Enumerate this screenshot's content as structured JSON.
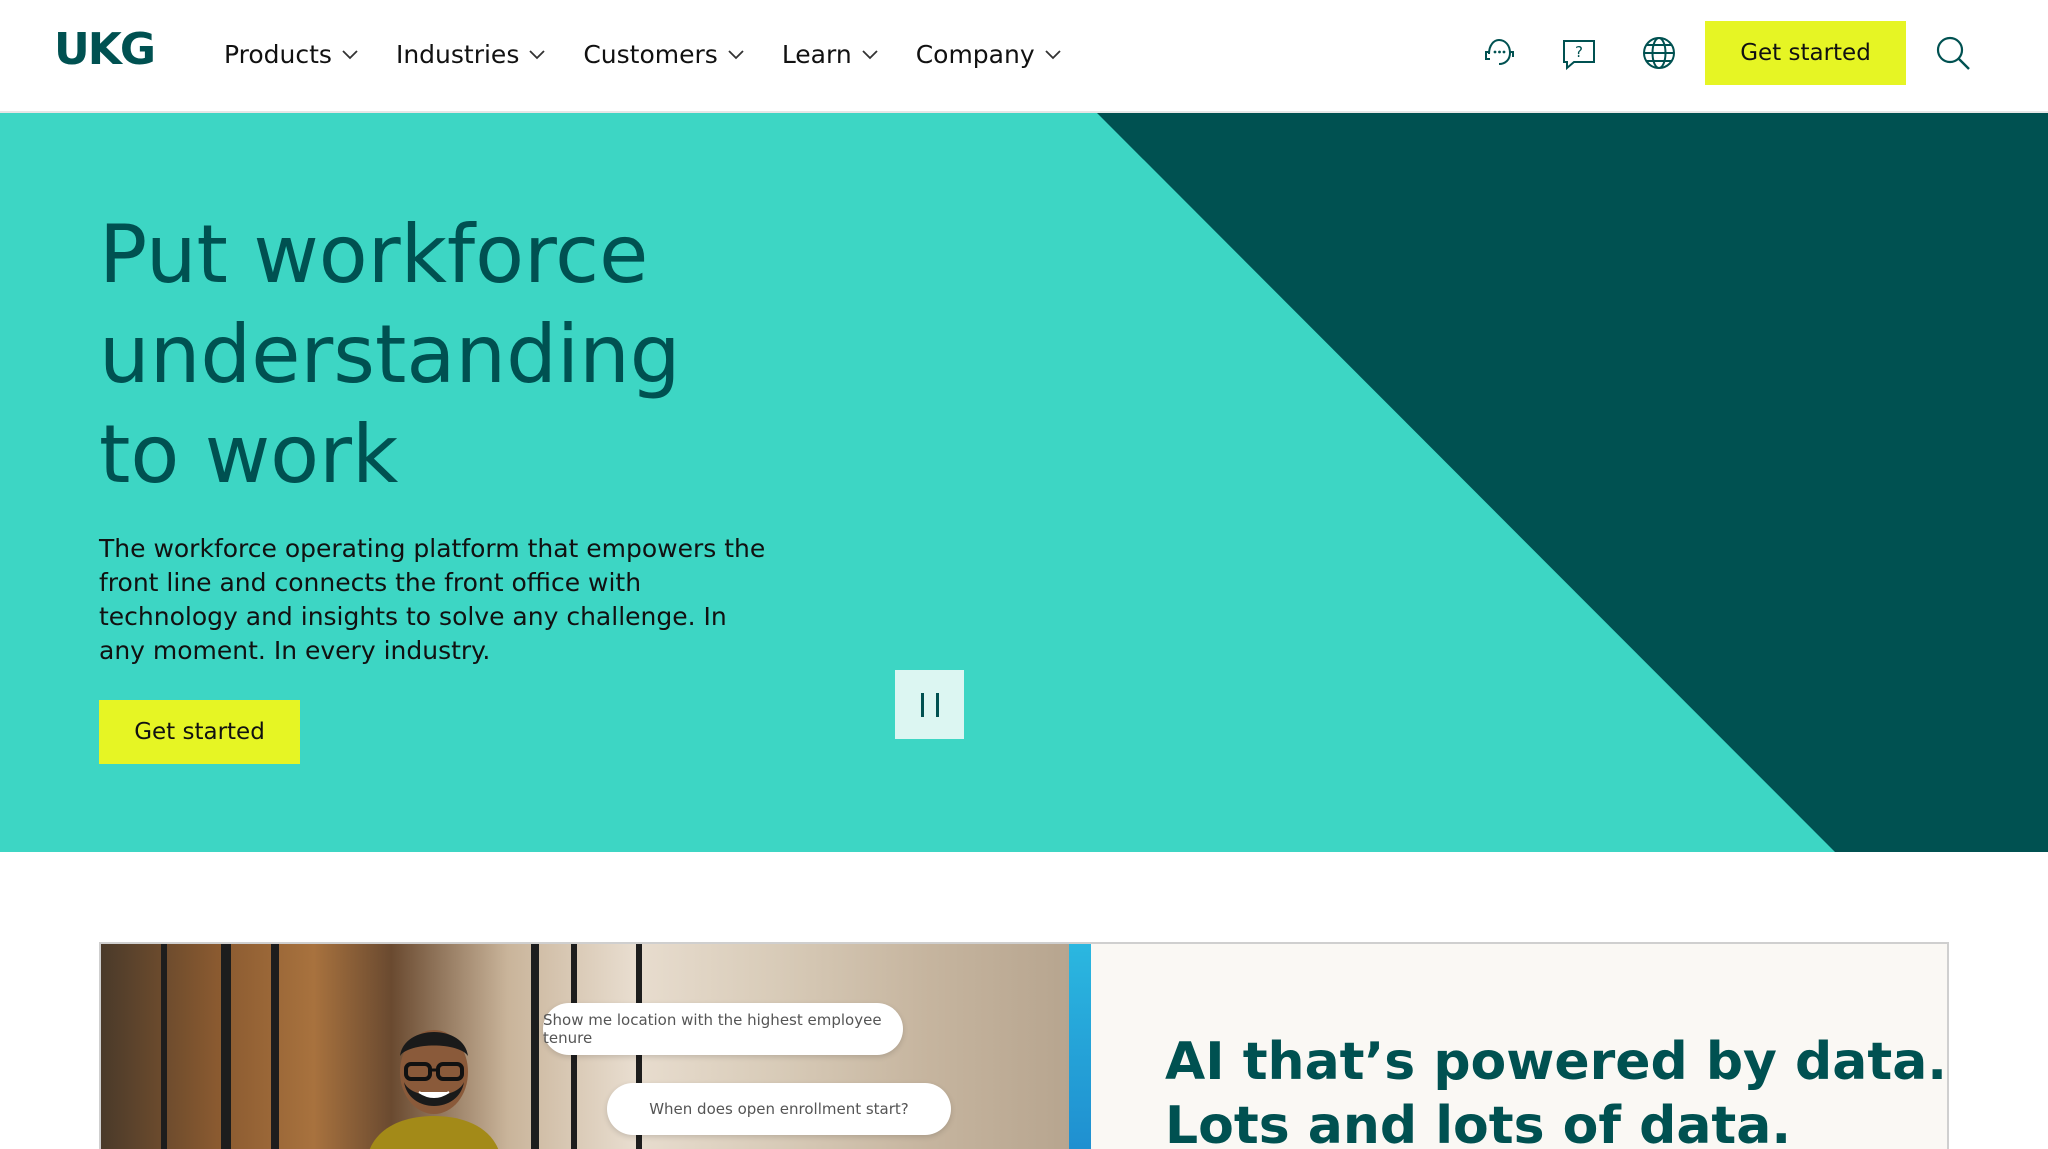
{
  "header": {
    "logo": "UKG",
    "nav": [
      {
        "label": "Products"
      },
      {
        "label": "Industries"
      },
      {
        "label": "Customers"
      },
      {
        "label": "Learn"
      },
      {
        "label": "Company"
      }
    ],
    "icons": [
      "support-chat-icon",
      "help-question-icon",
      "globe-icon",
      "search-icon"
    ],
    "cta_label": "Get started"
  },
  "hero": {
    "title_lines": [
      "Put workforce",
      "understanding",
      "to work"
    ],
    "description": "The workforce operating platform that empowers the front line and connects the front office with technology and insights to solve any challenge. In any moment. In every industry.",
    "cta_label": "Get started",
    "pause_icon": "pause-icon"
  },
  "feature": {
    "chips": [
      "Show me location with the highest employee tenure",
      "When does open enrollment start?"
    ],
    "title_lines": [
      "AI that’s powered by data.",
      "Lots and lots of data."
    ]
  },
  "colors": {
    "brand": "#005151",
    "hero_teal": "#3dd6c4",
    "hero_dark": "#005151",
    "cta_yellow": "#e6f524"
  }
}
